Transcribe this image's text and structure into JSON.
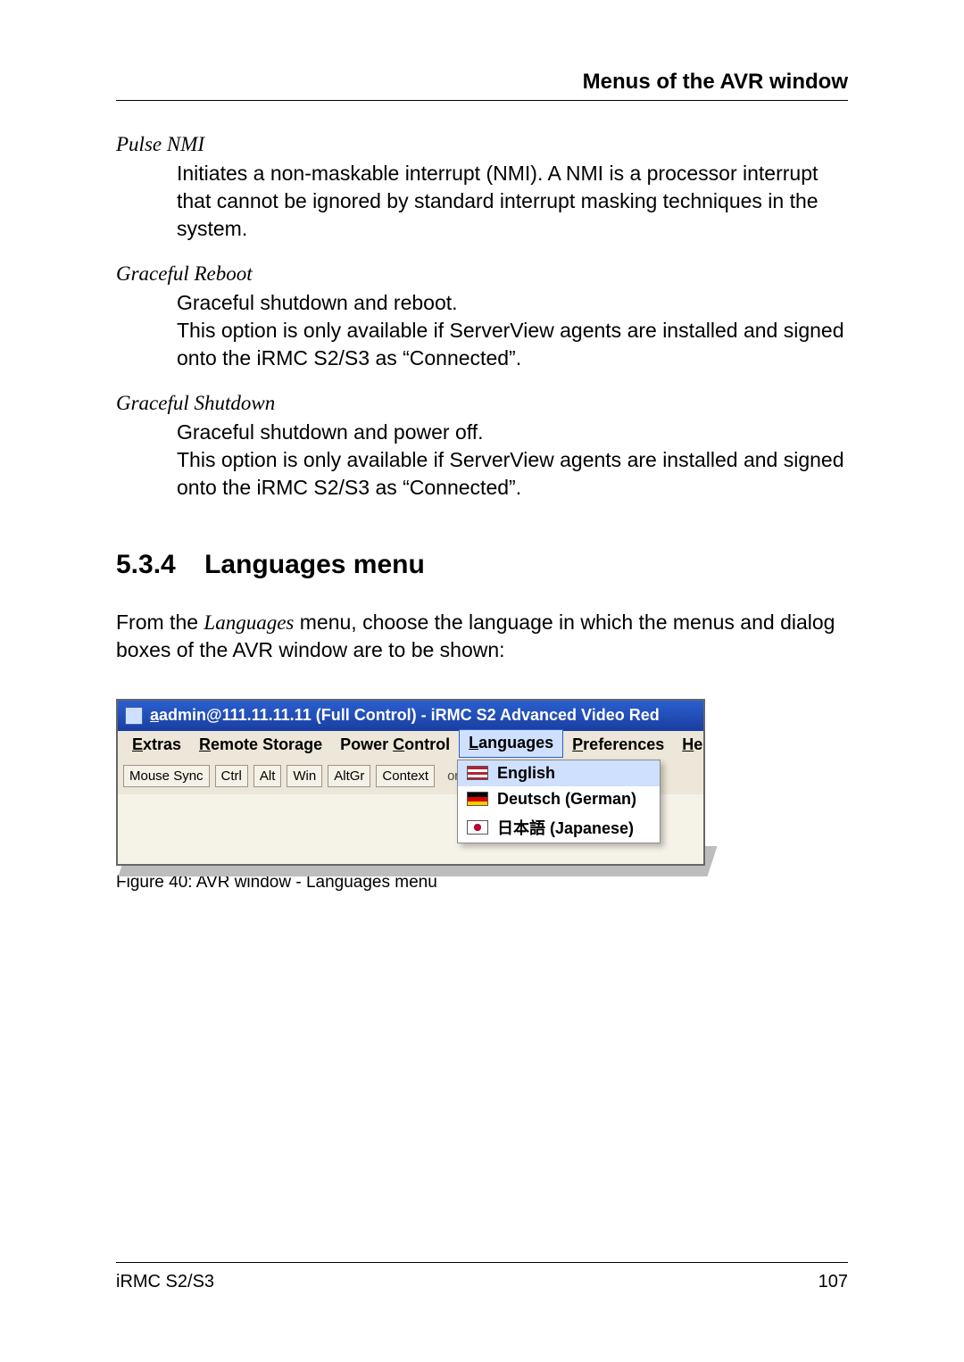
{
  "header": {
    "title": "Menus of the AVR window"
  },
  "sections": {
    "pulse": {
      "term": "Pulse NMI",
      "def": "Initiates a non-maskable interrupt (NMI). A NMI is a processor interrupt that cannot be ignored by standard interrupt masking techniques in the system."
    },
    "reboot": {
      "term": "Graceful Reboot",
      "def_l1": "Graceful shutdown and reboot.",
      "def_l2": "This option is only available if ServerView agents are installed and signed onto the iRMC S2/S3 as “Connected”."
    },
    "shutdown": {
      "term": "Graceful Shutdown",
      "def_l1": "Graceful shutdown and power off.",
      "def_l2": "This option is only available if ServerView agents are installed and signed onto the iRMC S2/S3 as “Connected”."
    }
  },
  "heading": {
    "number": "5.3.4",
    "title": "Languages menu"
  },
  "intro": {
    "pre": "From the ",
    "emph": "Languages",
    "post": " menu, choose the language in which the menus and dialog boxes of the AVR window are to be shown:"
  },
  "screenshot": {
    "titlebar_pre": "admin@111.11.11.11 (Full Control) - iRMC S2 Advanced Video Red",
    "menus": {
      "extras_u": "E",
      "extras_r": "xtras",
      "remote_u": "R",
      "remote_r": "emote Storage",
      "power_pre": "Power ",
      "power_u": "C",
      "power_post": "ontrol",
      "lang_u": "L",
      "lang_r": "anguages",
      "pref_u": "P",
      "pref_r": "references",
      "help_u": "H",
      "help_r": "elp"
    },
    "toolbar": {
      "mouse_sync": "Mouse Sync",
      "ctrl": "Ctrl",
      "alt": "Alt",
      "win": "Win",
      "altgr": "AltGr",
      "context": "Context",
      "trail": "or alwa"
    },
    "dropdown": {
      "english": "English",
      "german": "Deutsch (German)",
      "japanese": "日本語 (Japanese)"
    }
  },
  "figure_caption": "Figure 40: AVR window - Languages menu",
  "footer": {
    "left": "iRMC S2/S3",
    "right": "107"
  }
}
